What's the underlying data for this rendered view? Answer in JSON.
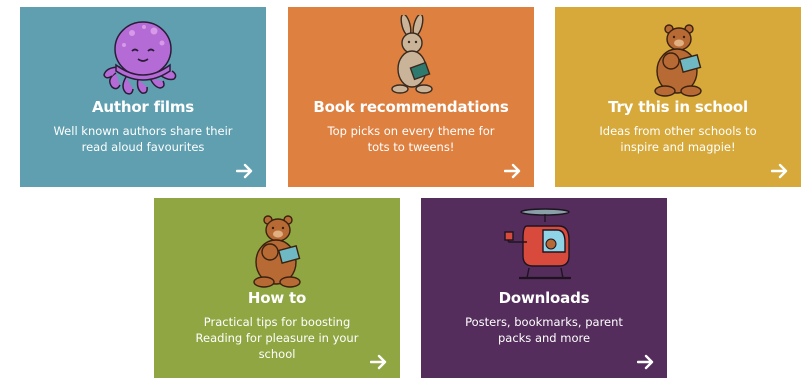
{
  "cards": [
    {
      "title": "Author films",
      "desc": "Well known authors share their read aloud favourites",
      "color": "#5f9fb0",
      "illustration": "octopus-icon"
    },
    {
      "title": "Book recommendations",
      "desc": "Top picks on every theme for tots to tweens!",
      "color": "#de8040",
      "illustration": "rabbit-reading-icon"
    },
    {
      "title": "Try this in school",
      "desc": "Ideas from other schools to inspire and magpie!",
      "color": "#d6a93a",
      "illustration": "bears-reading-icon"
    },
    {
      "title": "How to",
      "desc": "Practical tips for boosting Reading for pleasure in your school",
      "color": "#8fa642",
      "illustration": "bears-reading-icon"
    },
    {
      "title": "Downloads",
      "desc": "Posters, bookmarks, parent packs and more",
      "color": "#542d5c",
      "illustration": "helicopter-icon"
    }
  ]
}
